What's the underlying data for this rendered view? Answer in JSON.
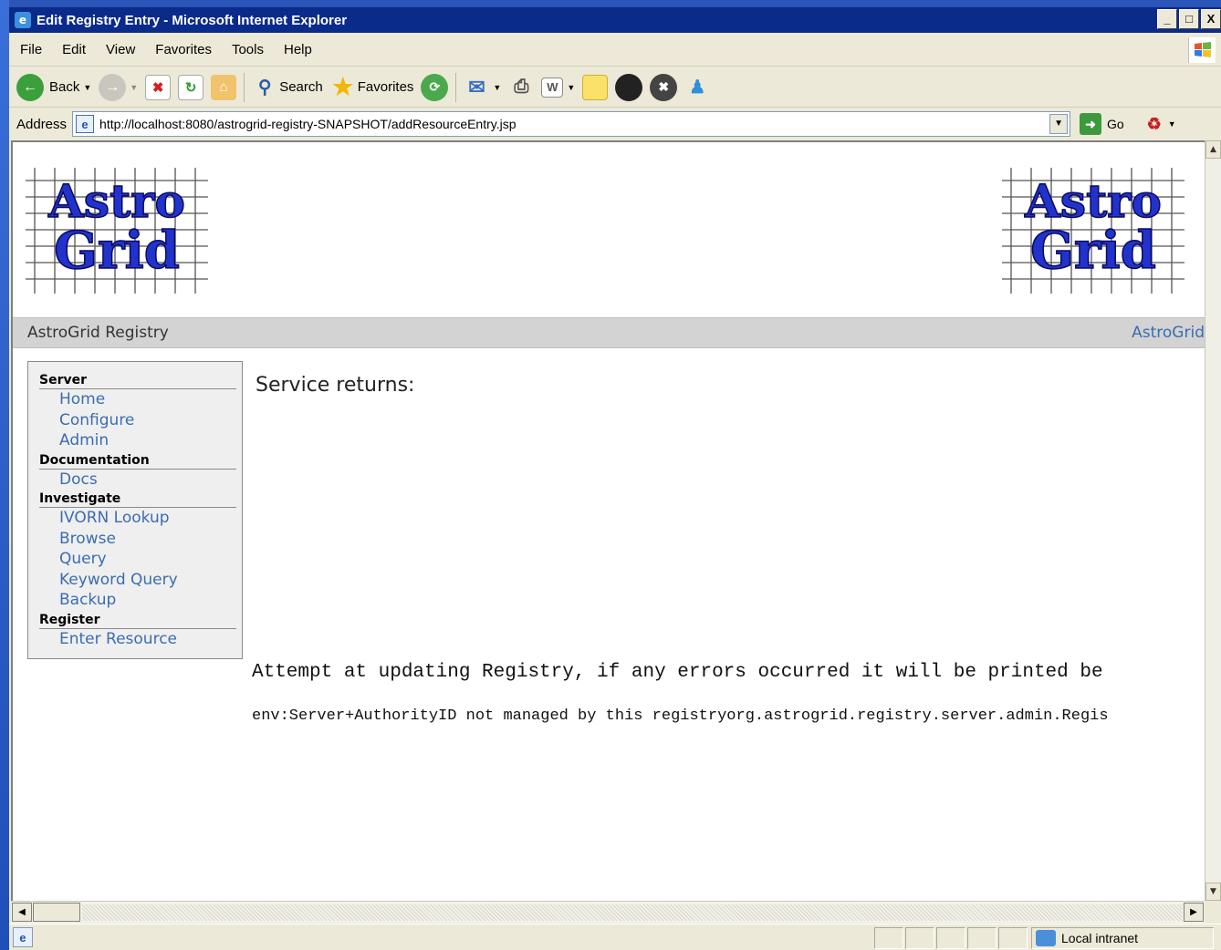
{
  "window": {
    "title": "Edit Registry Entry - Microsoft Internet Explorer",
    "controls": {
      "minimize": "_",
      "maximize": "□",
      "close": "X"
    }
  },
  "menu": [
    "File",
    "Edit",
    "View",
    "Favorites",
    "Tools",
    "Help"
  ],
  "toolbar": {
    "back_label": "Back",
    "search_label": "Search",
    "favorites_label": "Favorites"
  },
  "address": {
    "label": "Address",
    "url": "http://localhost:8080/astrogrid-registry-SNAPSHOT/addResourceEntry.jsp",
    "go_label": "Go"
  },
  "page": {
    "logo_text_top": "Astro",
    "logo_text_bottom": "Grid",
    "site_title": "AstroGrid Registry",
    "site_link": "AstroGrid",
    "sidebar": [
      {
        "heading": "Server",
        "items": [
          "Home",
          "Configure",
          "Admin"
        ]
      },
      {
        "heading": "Documentation",
        "items": [
          "Docs"
        ]
      },
      {
        "heading": "Investigate",
        "items": [
          "IVORN Lookup",
          "Browse",
          "Query",
          "Keyword Query",
          "Backup"
        ]
      },
      {
        "heading": "Register",
        "items": [
          "Enter Resource"
        ]
      }
    ],
    "service_returns": "Service returns:",
    "attempt_text": "Attempt at updating Registry, if any errors occurred it will be printed be",
    "error_text": "env:Server+AuthorityID not managed by this registryorg.astrogrid.registry.server.admin.Regis"
  },
  "status": {
    "zone_label": "Local intranet"
  },
  "colors": {
    "title_bar": "#0b2b8a",
    "link": "#3a6db0",
    "header_bar": "#d3d3d3"
  }
}
